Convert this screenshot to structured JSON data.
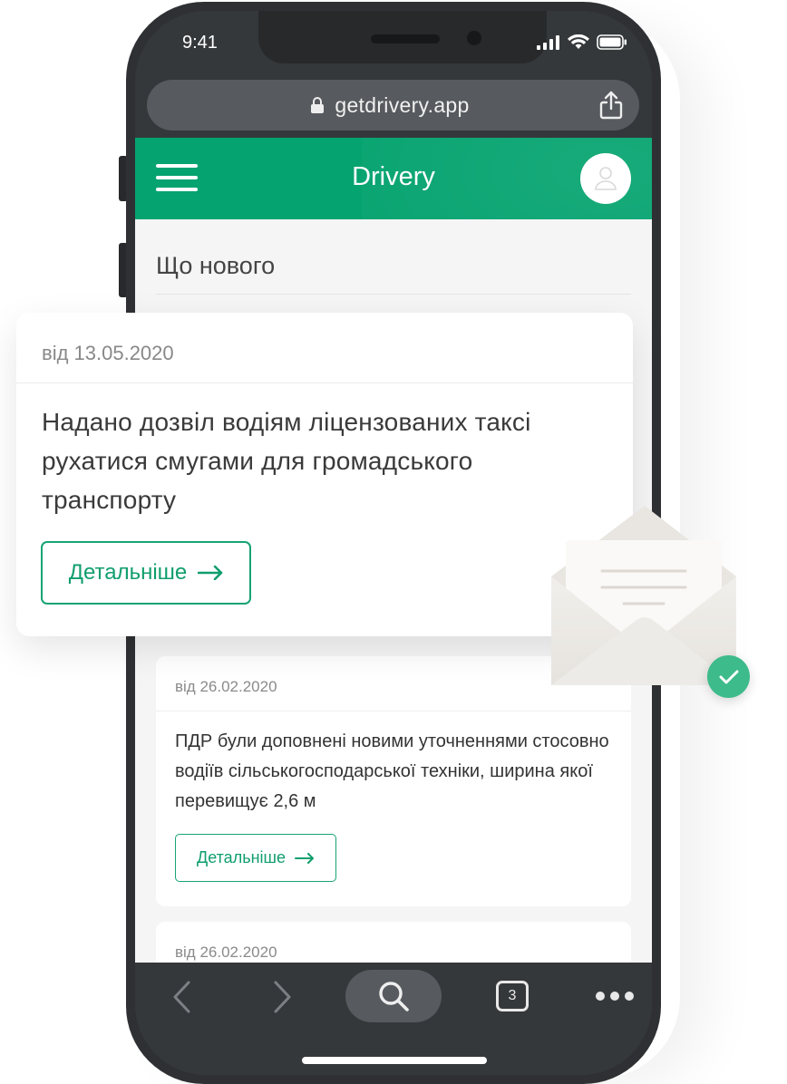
{
  "status_bar": {
    "time": "9:41"
  },
  "browser": {
    "url": "getdrivery.app",
    "open_tabs_count": "3"
  },
  "app": {
    "title": "Drivery",
    "section_title": "Що нового"
  },
  "news": [
    {
      "date": "від 13.05.2020",
      "text": "Надано дозвіл водіям ліцензованих таксі рухатися смугами для громадського транспорту",
      "button": "Детальніше"
    },
    {
      "date": "від 26.02.2020",
      "text": "ПДР були доповнені новими уточненнями стосовно водіїв сільськогосподарської техніки, ширина якої перевищує 2,6 м",
      "button": "Детальніше"
    },
    {
      "date": "від 26.02.2020"
    }
  ],
  "colors": {
    "brand_green": "#05a36f",
    "button_green": "#16a474",
    "check_badge": "#3dbb8b",
    "phone_body": "#2e3033"
  },
  "icons": [
    "hamburger-menu-icon",
    "user-icon",
    "lock-icon",
    "share-icon",
    "back-arrow-icon",
    "forward-arrow-icon",
    "search-icon",
    "tabs-icon",
    "more-icon",
    "envelope-icon",
    "check-icon",
    "arrow-right-icon",
    "signal-icon",
    "wifi-icon",
    "battery-icon"
  ]
}
